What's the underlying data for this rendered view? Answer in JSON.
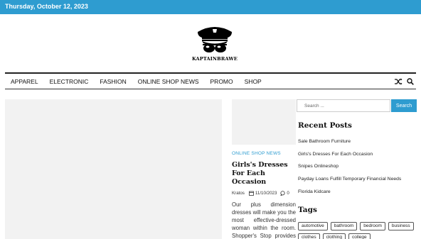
{
  "topbar": {
    "date": "Thursday, October 12, 2023",
    "color": "#2e9cd0"
  },
  "logo": {
    "text": "KAPTAINBRAWE",
    "icon": "captain-hat-sunglasses-icon"
  },
  "nav": {
    "items": [
      "APPAREL",
      "ELECTRONIC",
      "FASHION",
      "ONLINE SHOP NEWS",
      "PROMO",
      "SHOP"
    ],
    "icons": [
      "shuffle-icon",
      "search-icon"
    ]
  },
  "post": {
    "category": "ONLINE SHOP NEWS",
    "title": "Girls's Dresses For Each Occasion",
    "author": "Kratos",
    "date": "11/10/2023",
    "comments": "0",
    "excerpt": "Our plus dimension dresses will make you the most effective-dressed woman within the room. Shopper's Stop provides opt"
  },
  "sidebar": {
    "search": {
      "placeholder": "Search ...",
      "button": "Search"
    },
    "recent_title": "Recent Posts",
    "recent_posts": [
      "Sale Bathroom Furniture",
      "Girls's Dresses For Each Occasion",
      "Snipes Onlineshop",
      "Payday Loans Fulfill Temporary Financial Needs",
      "Florida Kidcare"
    ],
    "tags_title": "Tags",
    "tags": [
      "automotive",
      "bathroom",
      "bedroom",
      "business",
      "clothes",
      "clothing",
      "college"
    ]
  },
  "colors": {
    "accent": "#2e9cd0",
    "placeholder_bg": "#f2f2f2"
  }
}
